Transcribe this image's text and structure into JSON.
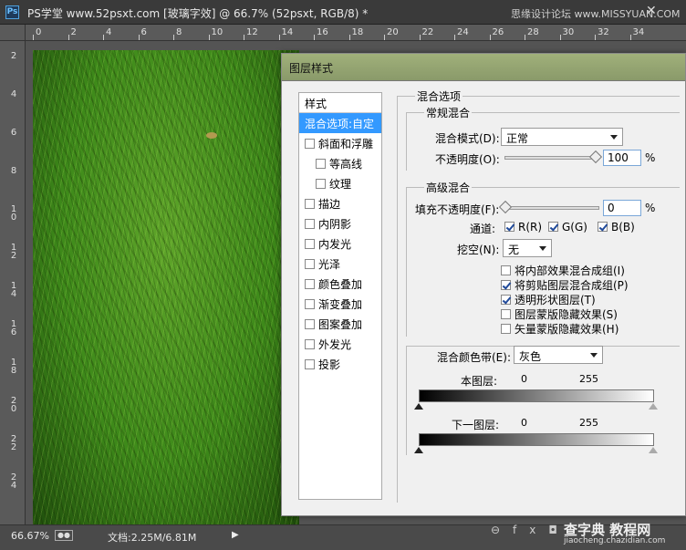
{
  "window": {
    "doc_title": "PS学堂 www.52psxt.com [玻璃字效] @ 66.7% (52psxt, RGB/8) *",
    "watermark": "思缘设计论坛 www.MISSYUAN.COM",
    "close": "✕"
  },
  "ruler": {
    "h": [
      "0",
      "2",
      "4",
      "6",
      "8",
      "10",
      "12",
      "14",
      "16",
      "18",
      "20",
      "22",
      "24",
      "26",
      "28",
      "30",
      "32",
      "34"
    ],
    "v": [
      "2",
      "4",
      "6",
      "8",
      "1\n0",
      "1\n2",
      "1\n4",
      "1\n6",
      "1\n8",
      "2\n0",
      "2\n2",
      "2\n4"
    ]
  },
  "status": {
    "zoom": "66.67%",
    "docsize": "文档:2.25M/6.81M",
    "play": "▶"
  },
  "bottom_watermark": {
    "main": "查字典 教程网",
    "url": "jiaocheng.chazidian.com"
  },
  "panel_icons": "⊖fx◘",
  "dialog": {
    "title": "图层样式",
    "style_list": {
      "header": "样式",
      "items": [
        {
          "label": "混合选项:自定",
          "selected": true,
          "checkbox": false,
          "indent": false
        },
        {
          "label": "斜面和浮雕",
          "checkbox": true,
          "checked": false,
          "indent": false
        },
        {
          "label": "等高线",
          "checkbox": true,
          "checked": false,
          "indent": true
        },
        {
          "label": "纹理",
          "checkbox": true,
          "checked": false,
          "indent": true
        },
        {
          "label": "描边",
          "checkbox": true,
          "checked": false,
          "indent": false
        },
        {
          "label": "内阴影",
          "checkbox": true,
          "checked": false,
          "indent": false
        },
        {
          "label": "内发光",
          "checkbox": true,
          "checked": false,
          "indent": false
        },
        {
          "label": "光泽",
          "checkbox": true,
          "checked": false,
          "indent": false
        },
        {
          "label": "颜色叠加",
          "checkbox": true,
          "checked": false,
          "indent": false
        },
        {
          "label": "渐变叠加",
          "checkbox": true,
          "checked": false,
          "indent": false
        },
        {
          "label": "图案叠加",
          "checkbox": true,
          "checked": false,
          "indent": false
        },
        {
          "label": "外发光",
          "checkbox": true,
          "checked": false,
          "indent": false
        },
        {
          "label": "投影",
          "checkbox": true,
          "checked": false,
          "indent": false
        }
      ]
    },
    "blend_options": {
      "section_title": "混合选项",
      "general": {
        "title": "常规混合",
        "mode_label": "混合模式(D):",
        "mode_value": "正常",
        "opacity_label": "不透明度(O):",
        "opacity_value": "100",
        "percent": "%"
      },
      "advanced": {
        "title": "高级混合",
        "fill_label": "填充不透明度(F):",
        "fill_value": "0",
        "percent": "%",
        "channels_label": "通道:",
        "channels": [
          {
            "label": "R(R)",
            "checked": true
          },
          {
            "label": "G(G)",
            "checked": true
          },
          {
            "label": "B(B)",
            "checked": true
          }
        ],
        "knockout_label": "挖空(N):",
        "knockout_value": "无",
        "options": [
          {
            "label": "将内部效果混合成组(I)",
            "checked": false
          },
          {
            "label": "将剪贴图层混合成组(P)",
            "checked": true
          },
          {
            "label": "透明形状图层(T)",
            "checked": true
          },
          {
            "label": "图层蒙版隐藏效果(S)",
            "checked": false
          },
          {
            "label": "矢量蒙版隐藏效果(H)",
            "checked": false
          }
        ]
      },
      "blend_if": {
        "label": "混合颜色带(E):",
        "value": "灰色",
        "this_layer": "本图层:",
        "this_min": "0",
        "this_max": "255",
        "under_layer": "下一图层:",
        "under_min": "0",
        "under_max": "255"
      }
    }
  }
}
